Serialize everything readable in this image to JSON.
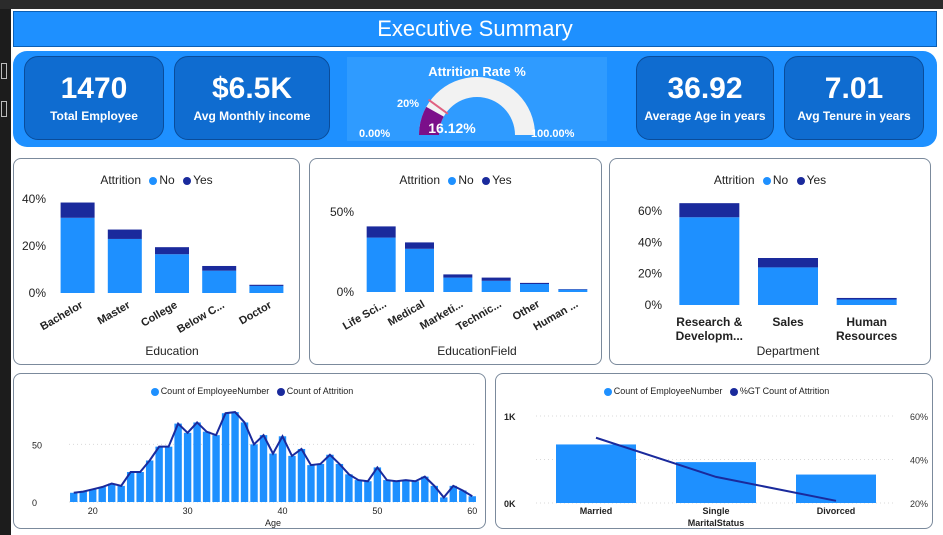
{
  "header": {
    "title": "Executive Summary"
  },
  "kpis": [
    {
      "value": "1470",
      "label": "Total Employee"
    },
    {
      "value": "$6.5K",
      "label": "Avg Monthly income"
    },
    {
      "value": "36.92",
      "label": "Average Age in years"
    },
    {
      "value": "7.01",
      "label": "Avg Tenure in years"
    }
  ],
  "gauge": {
    "title": "Attrition Rate %",
    "value_label": "16.12%",
    "min_label": "0.00%",
    "max_label": "100.00%",
    "target_label": "20%",
    "value": 16.12,
    "target": 20,
    "fill_color": "#7b0f8a",
    "track_color": "#f2f2f2",
    "target_color": "#e06080"
  },
  "colors": {
    "primary": "#1e90ff",
    "dark": "#1a2a9c",
    "canvas": "#ffffff"
  },
  "chart_data": [
    {
      "type": "bar",
      "stacked": true,
      "legend_title": "Attrition",
      "categories": [
        "Bachelor",
        "Master",
        "College",
        "Below C...",
        "Doctor"
      ],
      "series": [
        {
          "name": "No",
          "values": [
            32,
            23,
            16.5,
            9.5,
            3
          ],
          "color": "#1e90ff"
        },
        {
          "name": "Yes",
          "values": [
            6.5,
            4,
            3,
            2,
            0.5
          ],
          "color": "#1a2a9c"
        }
      ],
      "yticks": [
        "0%",
        "20%",
        "40%"
      ],
      "ylim": [
        0,
        40
      ],
      "xlabel": "Education"
    },
    {
      "type": "bar",
      "stacked": true,
      "legend_title": "Attrition",
      "categories": [
        "Life Sci...",
        "Medical",
        "Marketi...",
        "Technic...",
        "Other",
        "Human ..."
      ],
      "series": [
        {
          "name": "No",
          "values": [
            34,
            27,
            9,
            7,
            5,
            1.5
          ],
          "color": "#1e90ff"
        },
        {
          "name": "Yes",
          "values": [
            7,
            4,
            2,
            2,
            0.7,
            0.3
          ],
          "color": "#1a2a9c"
        }
      ],
      "yticks": [
        "0%",
        "50%"
      ],
      "ylim": [
        0,
        50
      ],
      "xlabel": "EducationField"
    },
    {
      "type": "bar",
      "stacked": true,
      "legend_title": "Attrition",
      "categories": [
        "Research & Developm...",
        "Sales",
        "Human Resources"
      ],
      "series": [
        {
          "name": "No",
          "values": [
            56,
            24,
            3.5
          ],
          "color": "#1e90ff"
        },
        {
          "name": "Yes",
          "values": [
            9,
            6,
            1
          ],
          "color": "#1a2a9c"
        }
      ],
      "yticks": [
        "0%",
        "20%",
        "40%",
        "60%"
      ],
      "ylim": [
        0,
        60
      ],
      "xlabel": "Department"
    },
    {
      "type": "bar",
      "legend": [
        "Count of EmployeeNumber",
        "Count of Attrition"
      ],
      "x": [
        18,
        19,
        20,
        21,
        22,
        23,
        24,
        25,
        26,
        27,
        28,
        29,
        30,
        31,
        32,
        33,
        34,
        35,
        36,
        37,
        38,
        39,
        40,
        41,
        42,
        43,
        44,
        45,
        46,
        47,
        48,
        49,
        50,
        51,
        52,
        53,
        54,
        55,
        56,
        57,
        58,
        59,
        60
      ],
      "values": [
        8,
        9,
        11,
        13,
        16,
        14,
        26,
        26,
        36,
        48,
        48,
        68,
        60,
        69,
        61,
        58,
        77,
        78,
        69,
        50,
        58,
        42,
        57,
        40,
        46,
        32,
        33,
        41,
        33,
        24,
        19,
        18,
        30,
        19,
        18,
        19,
        18,
        22,
        14,
        4,
        14,
        10,
        5
      ],
      "line_values": [
        8,
        9,
        11,
        13,
        16,
        14,
        26,
        26,
        36,
        48,
        48,
        68,
        60,
        69,
        61,
        58,
        77,
        78,
        69,
        50,
        58,
        42,
        57,
        40,
        46,
        32,
        33,
        41,
        33,
        24,
        19,
        18,
        30,
        19,
        18,
        19,
        18,
        22,
        14,
        4,
        14,
        10,
        5
      ],
      "xticks": [
        "20",
        "30",
        "40",
        "50",
        "60"
      ],
      "yticks": [
        "0",
        "50"
      ],
      "ylim": [
        0,
        85
      ],
      "xlabel": "Age"
    },
    {
      "type": "bar",
      "legend": [
        "Count of EmployeeNumber",
        "%GT Count of Attrition"
      ],
      "categories": [
        "Married",
        "Single",
        "Divorced"
      ],
      "values": [
        673,
        470,
        327
      ],
      "line_values": [
        50,
        32,
        21
      ],
      "yticks_left": [
        "0K",
        "1K"
      ],
      "ylim_left": [
        0,
        1000
      ],
      "yticks_right": [
        "20%",
        "40%",
        "60%"
      ],
      "ylim_right": [
        20,
        60
      ],
      "xlabel": "MaritalStatus"
    }
  ]
}
